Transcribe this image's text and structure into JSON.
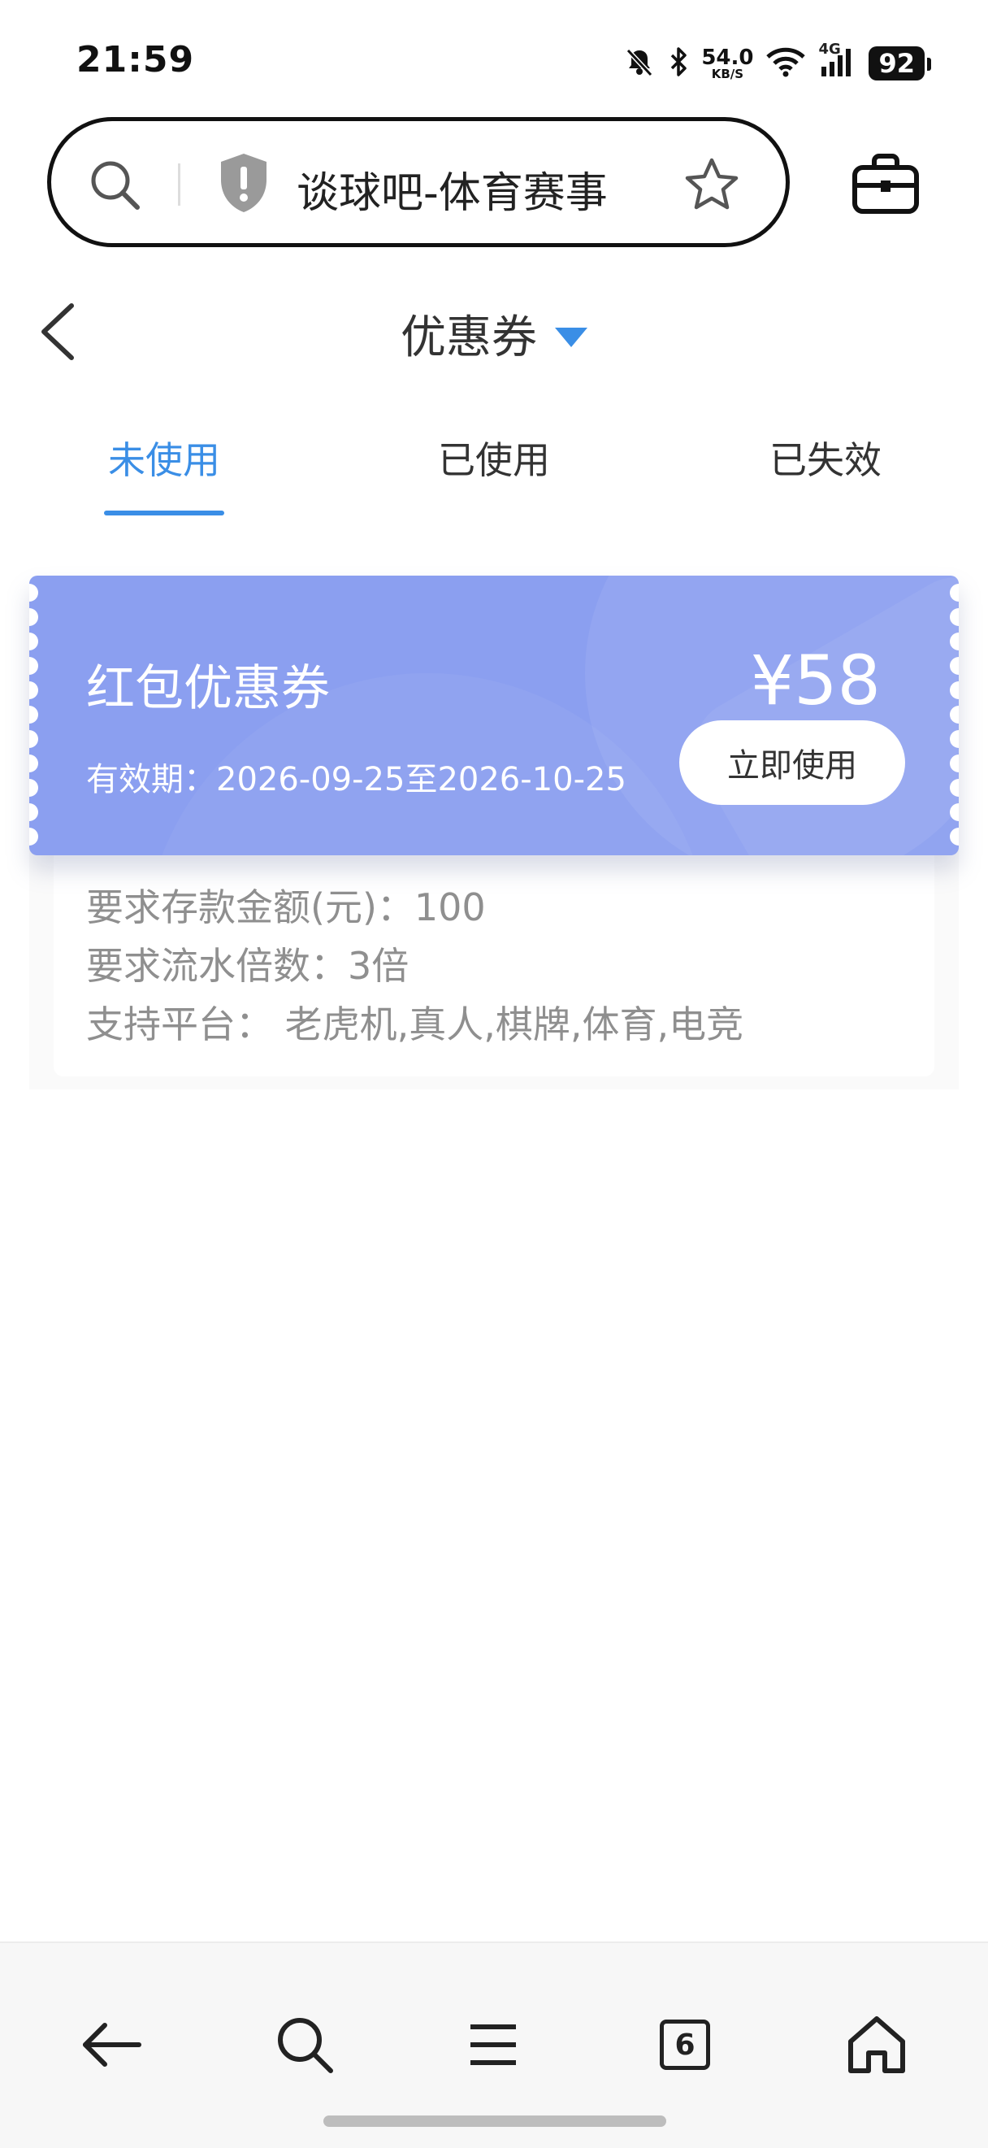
{
  "status_bar": {
    "time": "21:59",
    "net_speed_value": "54.0",
    "net_speed_unit": "KB/S",
    "network": "4G",
    "battery": "92",
    "icons": [
      "mute-icon",
      "bluetooth-icon",
      "wifi-icon",
      "signal-icon",
      "battery-icon"
    ]
  },
  "url_bar": {
    "title": "谈球吧-体育赛事"
  },
  "header": {
    "title": "优惠券"
  },
  "tabs": [
    {
      "label": "未使用",
      "active": true
    },
    {
      "label": "已使用",
      "active": false
    },
    {
      "label": "已失效",
      "active": false
    }
  ],
  "coupon": {
    "name": "红包优惠券",
    "amount": "¥58",
    "validity": "有效期：2026-09-25至2026-10-25",
    "button_label": "立即使用",
    "details": [
      "要求存款金额(元)：100",
      "要求流水倍数：3倍",
      "支持平台： 老虎机,真人,棋牌,体育,电竞"
    ]
  },
  "bottom_nav": {
    "tab_count": "6",
    "items": [
      "back-icon",
      "search-icon",
      "menu-icon",
      "tabs-icon",
      "home-icon"
    ]
  },
  "colors": {
    "accent": "#3a8ee6",
    "coupon_bg": "#8b9ff0"
  }
}
